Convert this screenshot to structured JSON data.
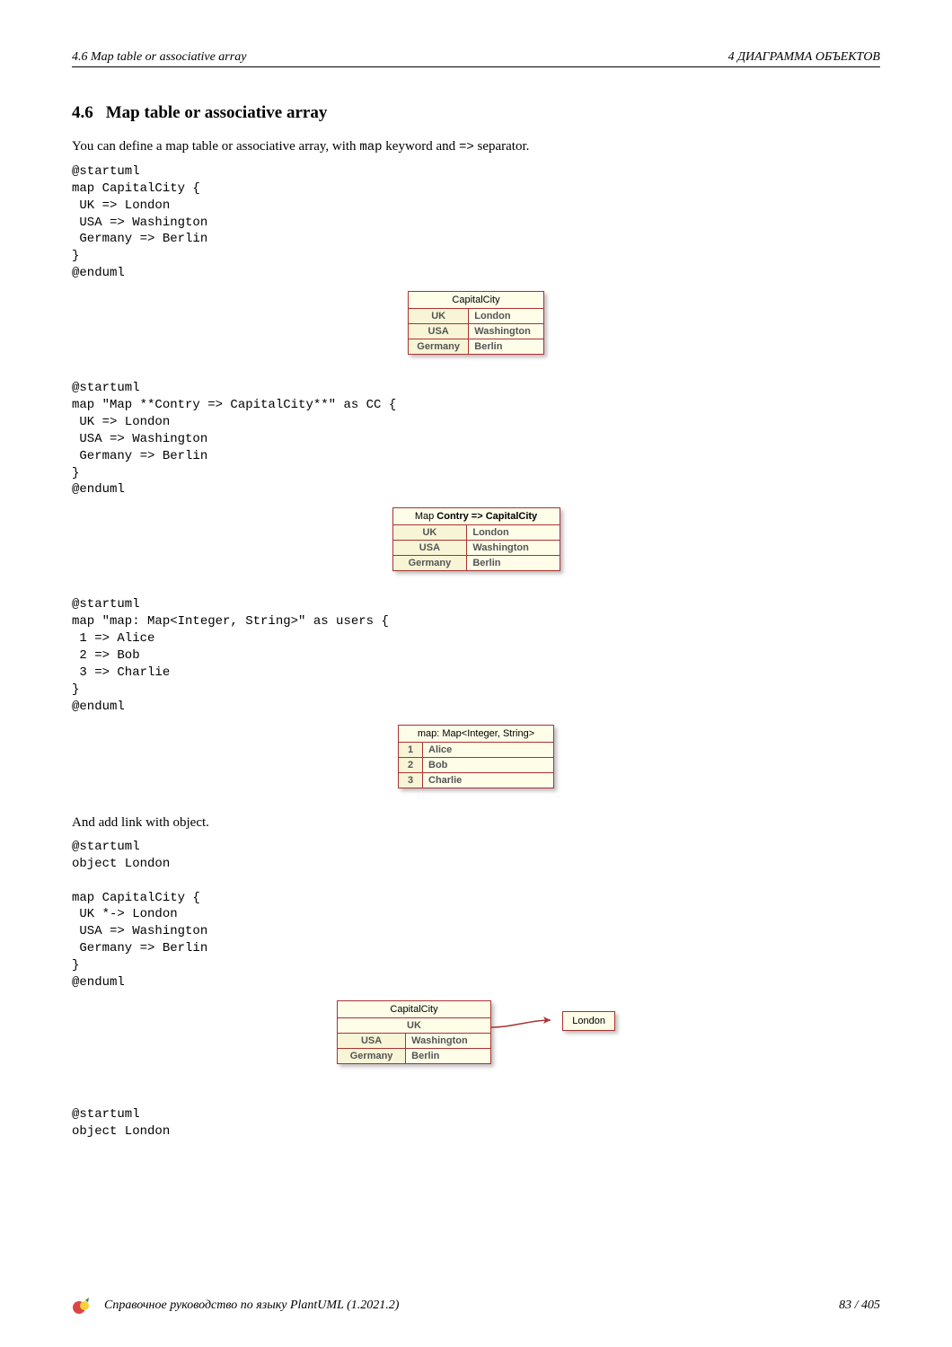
{
  "header": {
    "left": "4.6   Map table or associative array",
    "right": "4   ДИАГРАММА ОБЪЕКТОВ"
  },
  "section": {
    "number": "4.6",
    "title": "Map table or associative array"
  },
  "intro": {
    "before_map": "You can define a map table or associative array, with ",
    "map_kw": "map",
    "between": " keyword and ",
    "arrow_kw": "=>",
    "after": " separator."
  },
  "code1": "@startuml\nmap CapitalCity {\n UK => London\n USA => Washington\n Germany => Berlin\n}\n@enduml",
  "diagram1": {
    "title": "CapitalCity",
    "rows": [
      {
        "k": "UK",
        "v": "London"
      },
      {
        "k": "USA",
        "v": "Washington"
      },
      {
        "k": "Germany",
        "v": "Berlin"
      }
    ]
  },
  "code2": "@startuml\nmap \"Map **Contry => CapitalCity**\" as CC {\n UK => London\n USA => Washington\n Germany => Berlin\n}\n@enduml",
  "diagram2": {
    "title_prefix": "Map ",
    "title_bold": "Contry => CapitalCity",
    "rows": [
      {
        "k": "UK",
        "v": "London"
      },
      {
        "k": "USA",
        "v": "Washington"
      },
      {
        "k": "Germany",
        "v": "Berlin"
      }
    ]
  },
  "code3": "@startuml\nmap \"map: Map<Integer, String>\" as users {\n 1 => Alice\n 2 => Bob\n 3 => Charlie\n}\n@enduml",
  "diagram3": {
    "title": "map: Map<Integer, String>",
    "rows": [
      {
        "k": "1",
        "v": "Alice"
      },
      {
        "k": "2",
        "v": "Bob"
      },
      {
        "k": "3",
        "v": "Charlie"
      }
    ]
  },
  "mid_text": "And add link with object.",
  "code4": "@startuml\nobject London\n\nmap CapitalCity {\n UK *-> London\n USA => Washington\n Germany => Berlin\n}\n@enduml",
  "diagram4": {
    "title": "CapitalCity",
    "uk": "UK",
    "rows": [
      {
        "k": "USA",
        "v": "Washington"
      },
      {
        "k": "Germany",
        "v": "Berlin"
      }
    ],
    "linked_object": "London"
  },
  "code5": "@startuml\nobject London",
  "footer": {
    "text": "Справочное руководство по языку PlantUML (1.2021.2)",
    "page": "83 / 405"
  }
}
